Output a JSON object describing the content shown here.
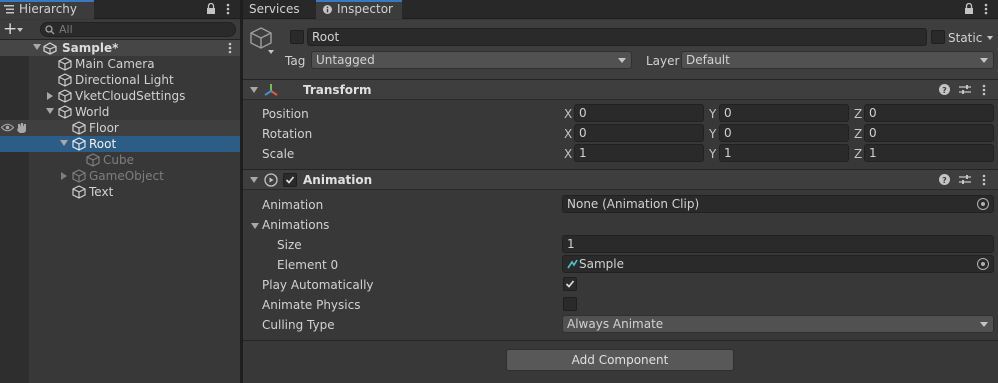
{
  "hierarchy": {
    "tab_label": "Hierarchy",
    "add_label": "+",
    "search_placeholder": "All",
    "scene": "Sample*",
    "items": {
      "main_camera": "Main Camera",
      "directional_light": "Directional Light",
      "vket": "VketCloudSettings",
      "world": "World",
      "floor": "Floor",
      "root": "Root",
      "cube": "Cube",
      "gameobject": "GameObject",
      "text": "Text"
    }
  },
  "tabs": {
    "services": "Services",
    "inspector": "Inspector"
  },
  "object": {
    "name": "Root",
    "static_label": "Static",
    "tag_label": "Tag",
    "tag_value": "Untagged",
    "layer_label": "Layer",
    "layer_value": "Default"
  },
  "transform": {
    "title": "Transform",
    "position_label": "Position",
    "rotation_label": "Rotation",
    "scale_label": "Scale",
    "x": "X",
    "y": "Y",
    "z": "Z",
    "position": {
      "x": "0",
      "y": "0",
      "z": "0"
    },
    "rotation": {
      "x": "0",
      "y": "0",
      "z": "0"
    },
    "scale": {
      "x": "1",
      "y": "1",
      "z": "1"
    }
  },
  "animation": {
    "title": "Animation",
    "animation_label": "Animation",
    "animation_value": "None (Animation Clip)",
    "animations_label": "Animations",
    "size_label": "Size",
    "size_value": "1",
    "element0_label": "Element 0",
    "element0_value": "Sample",
    "play_auto_label": "Play Automatically",
    "animate_physics_label": "Animate Physics",
    "culling_label": "Culling Type",
    "culling_value": "Always Animate"
  },
  "add_component_label": "Add Component",
  "colors": {
    "selection": "#2c5d87",
    "accent": "#3a79bb"
  }
}
